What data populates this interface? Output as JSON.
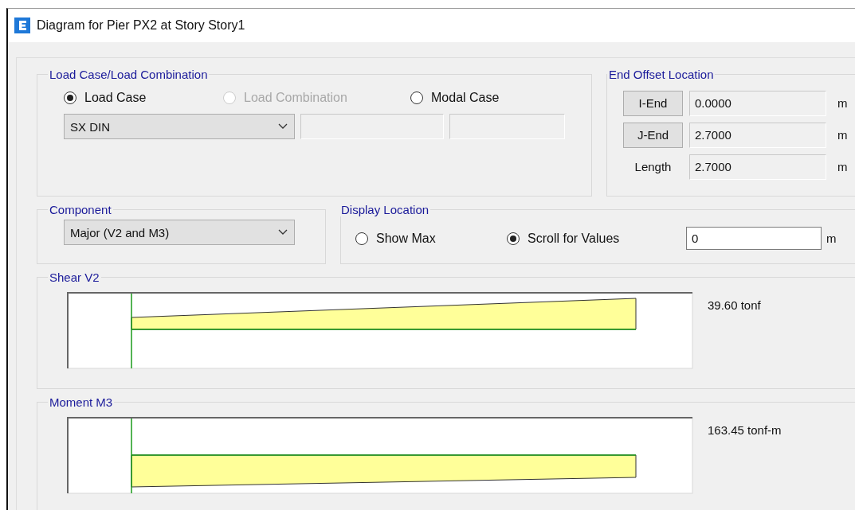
{
  "window": {
    "title": "Diagram for Pier PX2 at Story Story1"
  },
  "load_case_group": {
    "title": "Load Case/Load Combination",
    "options": [
      {
        "label": "Load Case",
        "selected": true,
        "disabled": false
      },
      {
        "label": "Load Combination",
        "selected": false,
        "disabled": true
      },
      {
        "label": "Modal Case",
        "selected": false,
        "disabled": false
      }
    ],
    "case_dropdown": {
      "value": "SX DIN"
    }
  },
  "end_offset": {
    "title": "End Offset Location",
    "rows": [
      {
        "kind": "button",
        "label": "I-End",
        "value": "0.0000",
        "unit": "m"
      },
      {
        "kind": "button",
        "label": "J-End",
        "value": "2.7000",
        "unit": "m"
      },
      {
        "kind": "label",
        "label": "Length",
        "value": "2.7000",
        "unit": "m"
      }
    ]
  },
  "component": {
    "title": "Component",
    "dropdown": {
      "value": "Major (V2 and M3)"
    }
  },
  "display_location": {
    "title": "Display Location",
    "options": [
      {
        "label": "Show Max",
        "selected": false
      },
      {
        "label": "Scroll for Values",
        "selected": true
      }
    ],
    "value": "0",
    "unit": "m"
  },
  "diagrams": [
    {
      "kind": "shear",
      "title": "Shear V2",
      "reading": "39.60 tonf"
    },
    {
      "kind": "moment",
      "title": "Moment M3",
      "reading": "163.45 tonf-m"
    }
  ]
}
